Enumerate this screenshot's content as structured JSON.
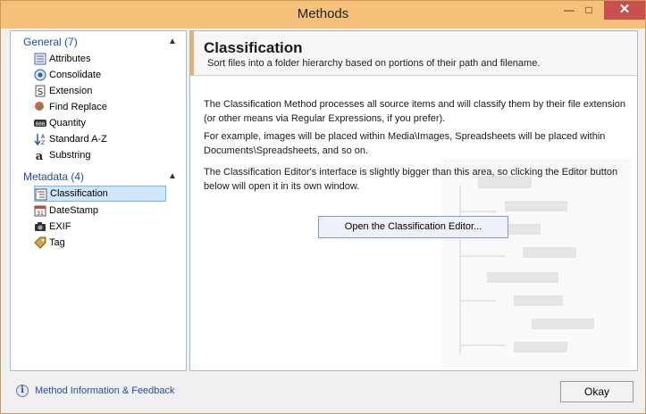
{
  "window": {
    "title": "Methods",
    "min": "—",
    "max": "□",
    "close": "✕"
  },
  "sidebar": {
    "groups": [
      {
        "label": "General (7)",
        "chevron": "▲",
        "items": [
          {
            "label": "Attributes",
            "icon": "attributes-icon"
          },
          {
            "label": "Consolidate",
            "icon": "consolidate-icon"
          },
          {
            "label": "Extension",
            "icon": "extension-icon"
          },
          {
            "label": "Find Replace",
            "icon": "find-replace-icon"
          },
          {
            "label": "Quantity",
            "icon": "quantity-icon"
          },
          {
            "label": "Standard A-Z",
            "icon": "sort-az-icon"
          },
          {
            "label": "Substring",
            "icon": "substring-icon"
          }
        ]
      },
      {
        "label": "Metadata (4)",
        "chevron": "▲",
        "items": [
          {
            "label": "Classification",
            "icon": "classification-icon",
            "selected": true
          },
          {
            "label": "DateStamp",
            "icon": "datestamp-icon"
          },
          {
            "label": "EXIF",
            "icon": "camera-icon"
          },
          {
            "label": "Tag",
            "icon": "tag-icon"
          }
        ]
      }
    ]
  },
  "main": {
    "title": "Classification",
    "subtitle": "Sort files into a folder hierarchy based on portions of their path and filename.",
    "p1": "The Classification Method processes all source items and will classify them by their file extension (or other means via Regular Expressions, if you prefer).",
    "p2": "For example, images will be placed within Media\\Images, Spreadsheets will be placed within Documents\\Spreadsheets, and so on.",
    "p3": "The Classification Editor's interface is slightly bigger than this area, so clicking the Editor button below will open it in its own window.",
    "editor_button": "Open the Classification Editor..."
  },
  "footer": {
    "info_link": "Method Information & Feedback",
    "okay": "Okay"
  },
  "colors": {
    "titlebar": "#f5c07a",
    "close": "#c7504f",
    "link": "#1e4fa0",
    "selection": "#cfe6fb"
  }
}
